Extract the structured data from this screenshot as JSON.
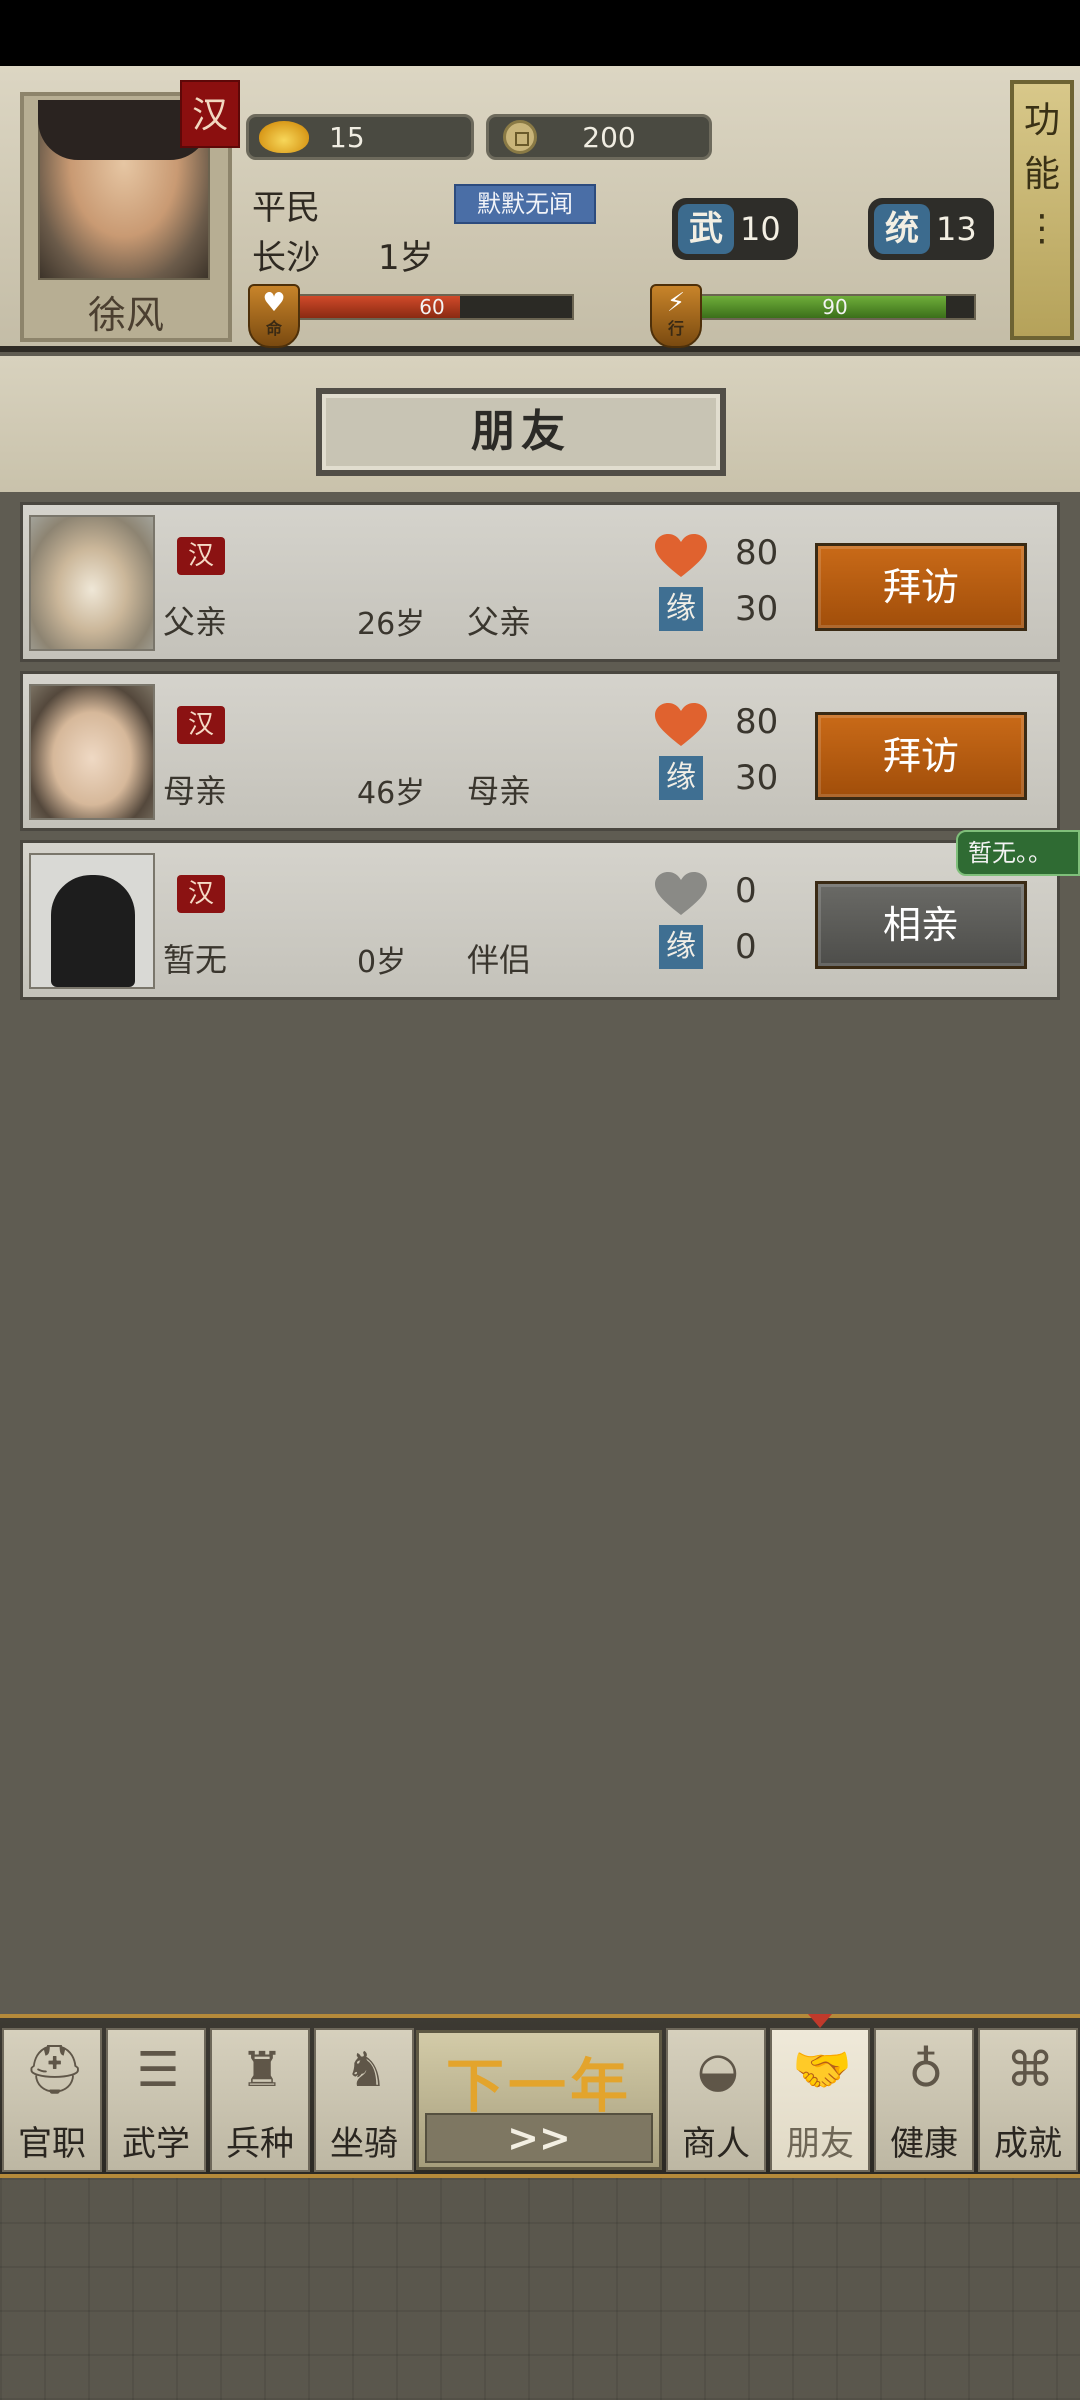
{
  "player": {
    "name": "徐风",
    "faction": "汉",
    "gold": "15",
    "coins": "200",
    "rank": "平民",
    "city": "长沙",
    "age": "1岁",
    "fame": "默默无闻",
    "stats": {
      "wu_label": "武",
      "wu": "10",
      "tong_label": "统",
      "tong": "13"
    },
    "hp": {
      "label": "命",
      "value": "60",
      "fraction": 0.6
    },
    "ap": {
      "label": "行",
      "value": "90",
      "fraction": 0.9
    }
  },
  "function_button": {
    "label_1": "功",
    "label_2": "能",
    "label_3": "⋮"
  },
  "page_title": "朋友",
  "friends": [
    {
      "faction": "汉",
      "name": "父亲",
      "age": "26岁",
      "relation": "父亲",
      "affection": "80",
      "yuan_label": "缘",
      "yuan": "30",
      "action": "拜访",
      "heart_color": "#e0622f"
    },
    {
      "faction": "汉",
      "name": "母亲",
      "age": "46岁",
      "relation": "母亲",
      "affection": "80",
      "yuan_label": "缘",
      "yuan": "30",
      "action": "拜访",
      "heart_color": "#e0622f"
    },
    {
      "faction": "汉",
      "name": "暂无",
      "age": "0岁",
      "relation": "伴侣",
      "affection": "0",
      "yuan_label": "缘",
      "yuan": "0",
      "action": "相亲",
      "heart_color": "#8a8a86"
    }
  ],
  "tooltip": "暂无。。",
  "nav": {
    "items": [
      {
        "label": "官职",
        "icon": "helmet-icon"
      },
      {
        "label": "武学",
        "icon": "scroll-icon"
      },
      {
        "label": "兵种",
        "icon": "soldier-icon"
      },
      {
        "label": "坐骑",
        "icon": "horse-icon"
      },
      {
        "label": "商人",
        "icon": "ingot-icon"
      },
      {
        "label": "朋友",
        "icon": "handshake-icon"
      },
      {
        "label": "健康",
        "icon": "gourd-icon"
      },
      {
        "label": "成就",
        "icon": "map-icon"
      }
    ],
    "next_year": "下一年",
    "next_arrows": ">>"
  },
  "colors": {
    "accent_orange": "#c96a18",
    "faction_red": "#8b1212",
    "header_bg": "#d6cfba"
  }
}
